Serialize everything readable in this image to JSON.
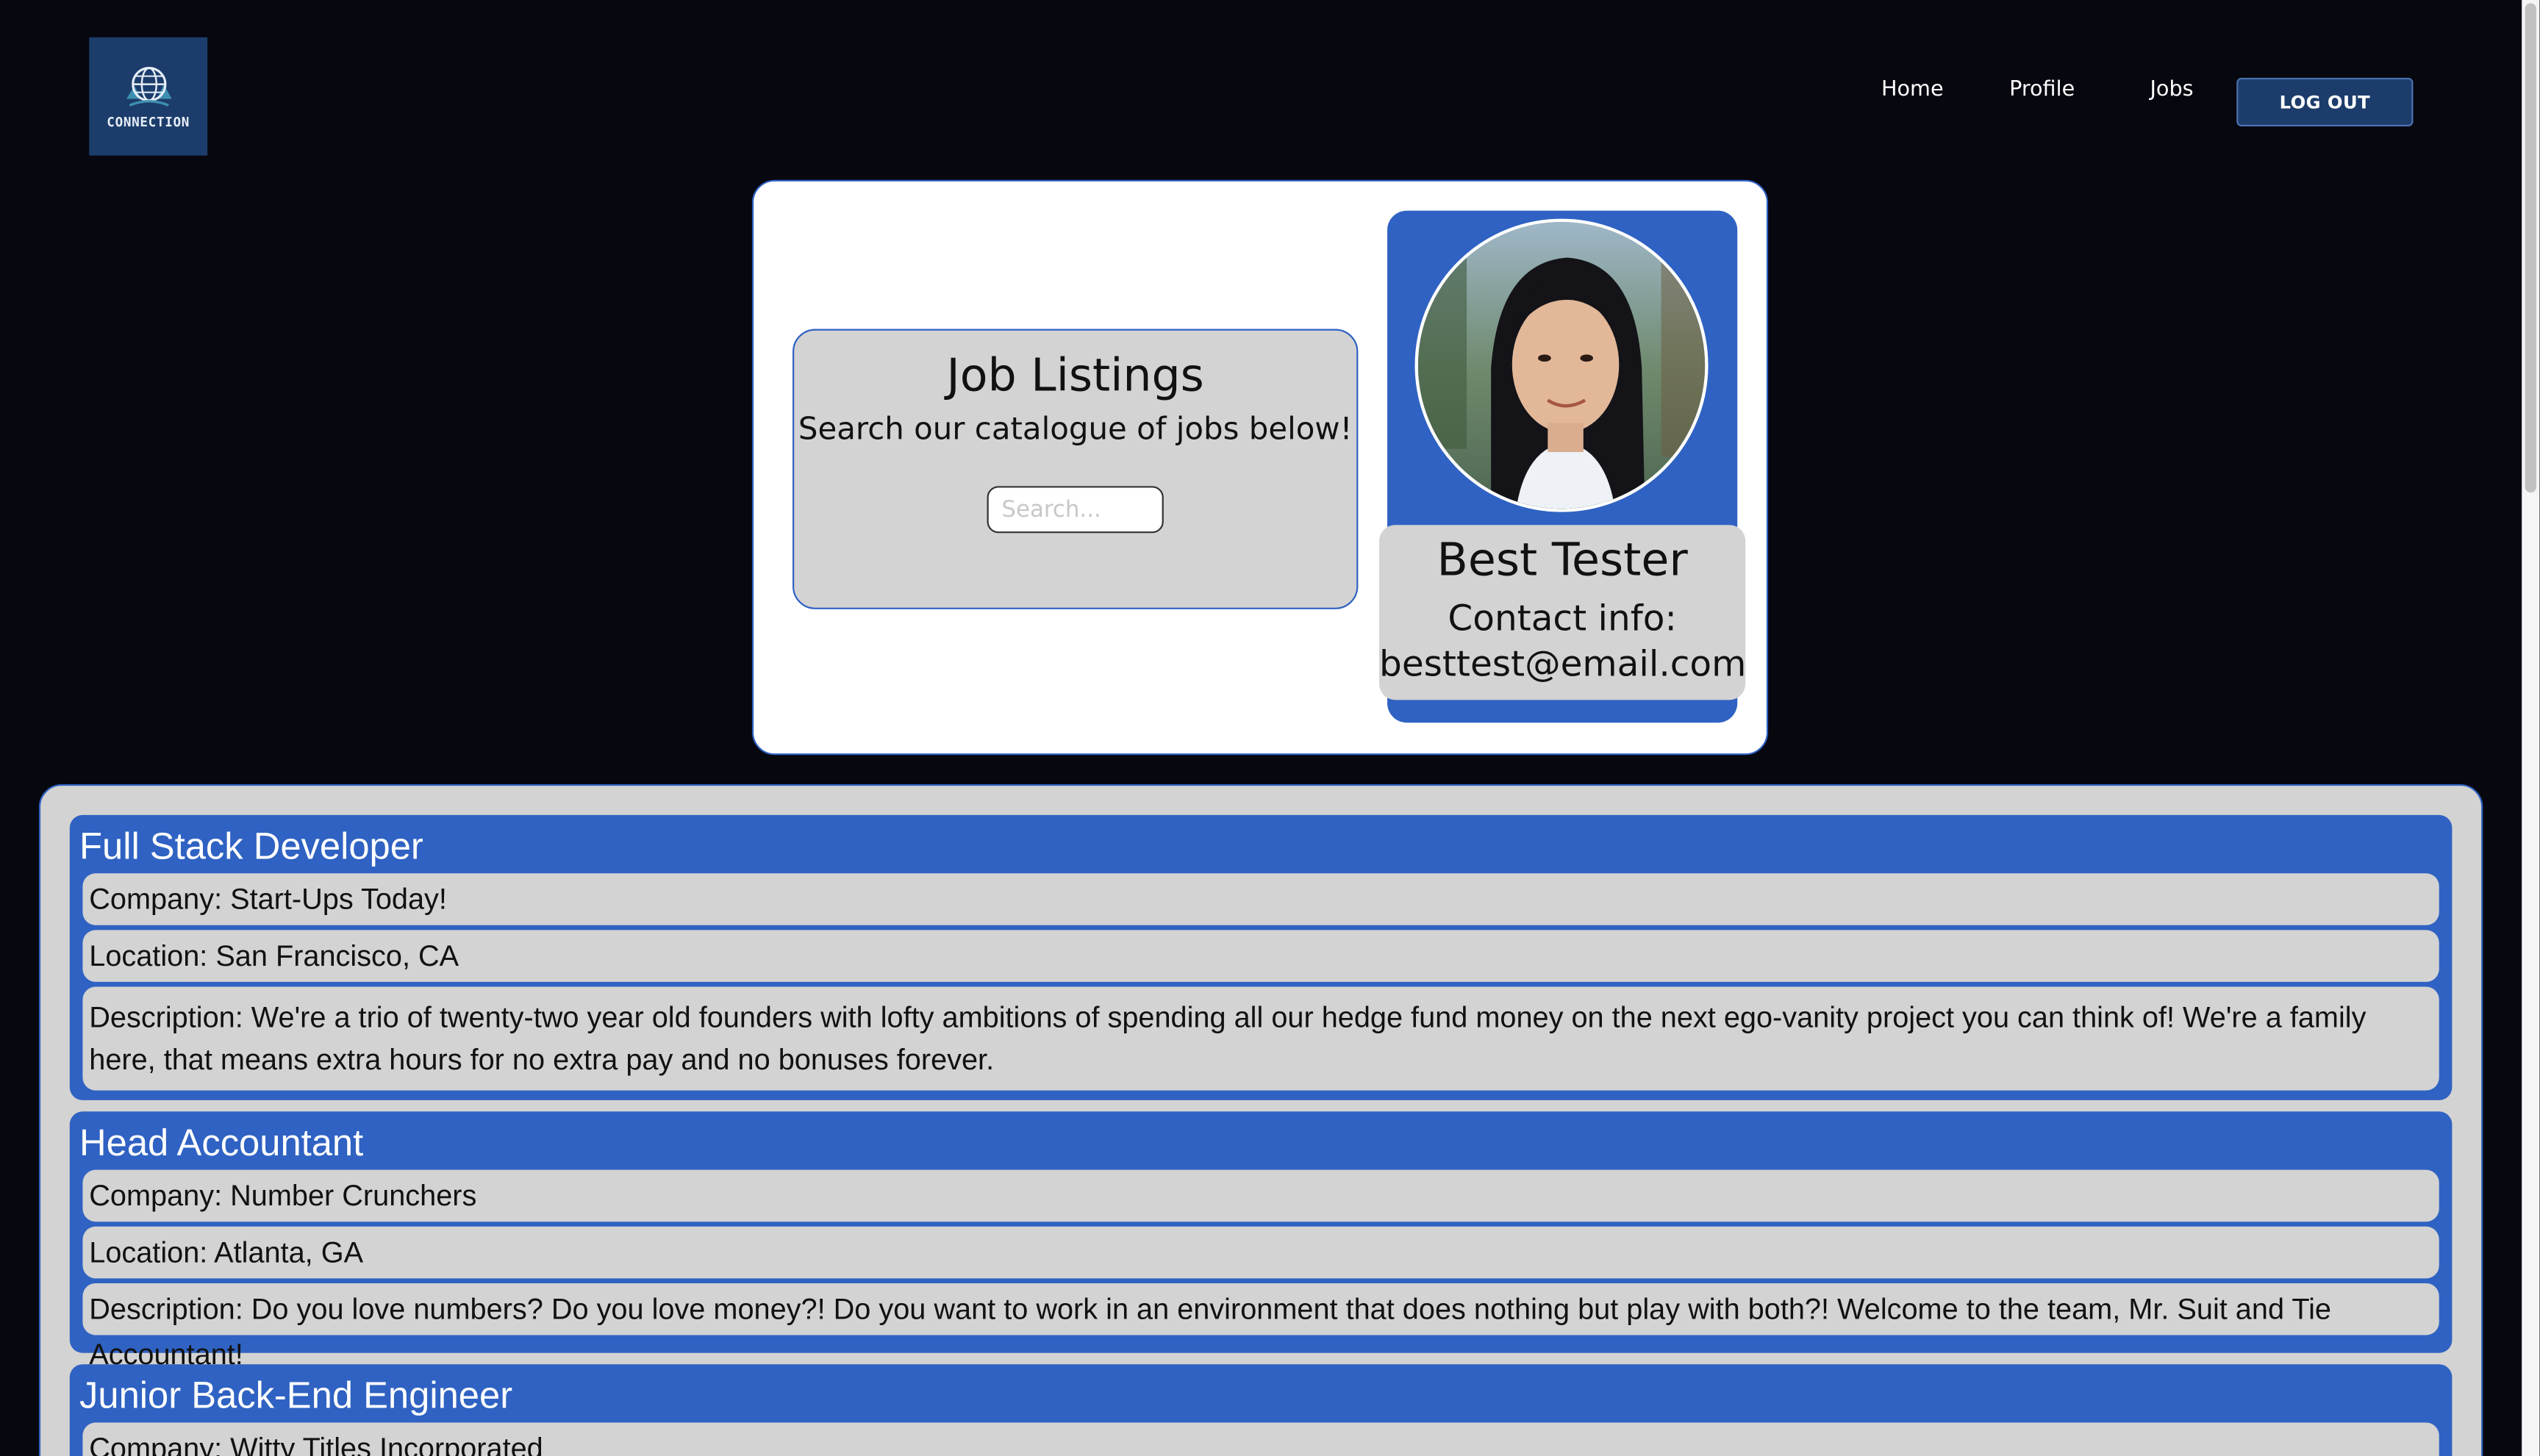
{
  "header": {
    "logo_text": "CONNECTION",
    "nav": [
      "Home",
      "Profile",
      "Jobs"
    ],
    "logout_label": "LOG OUT"
  },
  "hero": {
    "title": "Job Listings",
    "subtitle": "Search our catalogue of jobs below!",
    "search_placeholder": "Search..."
  },
  "profile": {
    "name": "Best Tester",
    "contact_label": "Contact info:",
    "email": "besttest@email.com"
  },
  "jobs": [
    {
      "title": "Full Stack Developer",
      "company": "Company: Start-Ups Today!",
      "location": "Location: San Francisco, CA",
      "description": "Description: We're a trio of twenty-two year old founders with lofty ambitions of spending all our hedge fund money on the next ego-vanity project you can think of! We're a family here, that means extra hours for no extra pay and no bonuses forever."
    },
    {
      "title": "Head Accountant",
      "company": "Company: Number Crunchers",
      "location": "Location: Atlanta, GA",
      "description": "Description: Do you love numbers? Do you love money?! Do you want to work in an environment that does nothing but play with both?! Welcome to the team, Mr. Suit and Tie Accountant!"
    },
    {
      "title": "Junior Back-End Engineer",
      "company": "Company: Witty Titles Incorporated",
      "location": "",
      "description": ""
    }
  ],
  "colors": {
    "background": "#07070f",
    "accent": "#2f62c2",
    "panel": "#d3d3d3",
    "logo_bg": "#1c3d6b"
  }
}
